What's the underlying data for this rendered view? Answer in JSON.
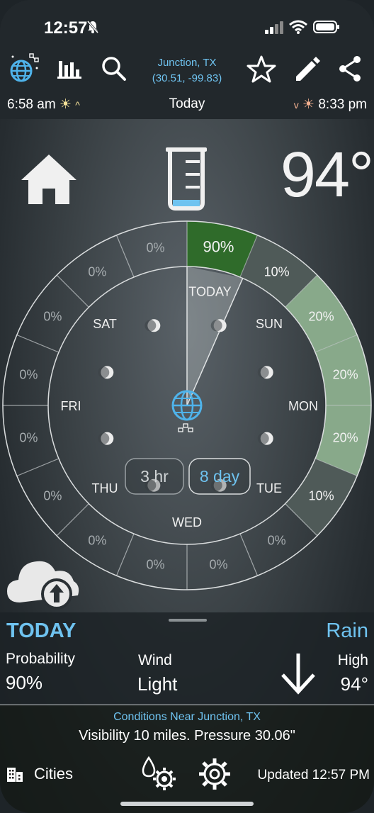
{
  "status": {
    "time": "12:57"
  },
  "toolbar": {
    "location_name": "Junction, TX",
    "location_coords": "(30.51, -99.83)",
    "sunrise": "6:58 am",
    "day_label": "Today",
    "sunset": "8:33 pm"
  },
  "current": {
    "temperature": "94°"
  },
  "dial": {
    "outer_labels": [
      "90%",
      "10%",
      "20%",
      "20%",
      "20%",
      "10%",
      "0%",
      "0%",
      "0%",
      "0%",
      "0%",
      "0%",
      "0%",
      "0%",
      "0%",
      "0%"
    ],
    "outer_levels": [
      0.9,
      0.1,
      0.2,
      0.2,
      0.2,
      0.1,
      0,
      0,
      0,
      0,
      0,
      0,
      0,
      0,
      0,
      0
    ],
    "days": [
      "TODAY",
      "SUN",
      "MON",
      "TUE",
      "WED",
      "THU",
      "FRI",
      "SAT"
    ],
    "mode_3hr": "3 hr",
    "mode_8day": "8 day",
    "colors": {
      "high": "#2f6b2a",
      "mid": "#88a98a",
      "low": "#4f5a58",
      "accent": "#6fc3f0"
    }
  },
  "summary": {
    "title": "TODAY",
    "type": "Rain",
    "probability_label": "Probability",
    "probability_value": "90%",
    "wind_label": "Wind",
    "wind_value": "Light",
    "high_label": "High",
    "high_value": "94°"
  },
  "conditions": {
    "title": "Conditions Near Junction, TX",
    "text": "Visibility 10 miles. Pressure 30.06\""
  },
  "footer": {
    "cities_label": "Cities",
    "updated": "Updated 12:57 PM"
  }
}
